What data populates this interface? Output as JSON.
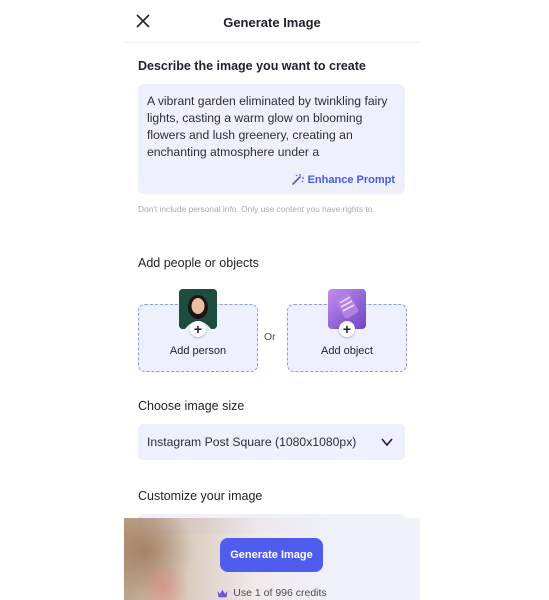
{
  "header": {
    "title": "Generate Image"
  },
  "prompt": {
    "label": "Describe the image you want to create",
    "text": "A vibrant garden eliminated by twinkling fairy lights, casting a warm glow on blooming flowers and lush greenery, creating an enchanting atmosphere under a",
    "enhance_label": "Enhance Prompt",
    "disclaimer": "Don't include personal info. Only use content you have rights to."
  },
  "add_section": {
    "label": "Add people or objects",
    "person_label": "Add person",
    "or_label": "Or",
    "object_label": "Add object"
  },
  "size": {
    "label": "Choose image size",
    "selected": "Instagram Post Square (1080x1080px)"
  },
  "customize": {
    "label": "Customize your image"
  },
  "footer": {
    "generate_label": "Generate Image",
    "credits_text": "Use 1 of 996 credits"
  },
  "colors": {
    "accent": "#4e5dee",
    "field_bg": "#eef0fd",
    "link": "#4a57e8"
  }
}
